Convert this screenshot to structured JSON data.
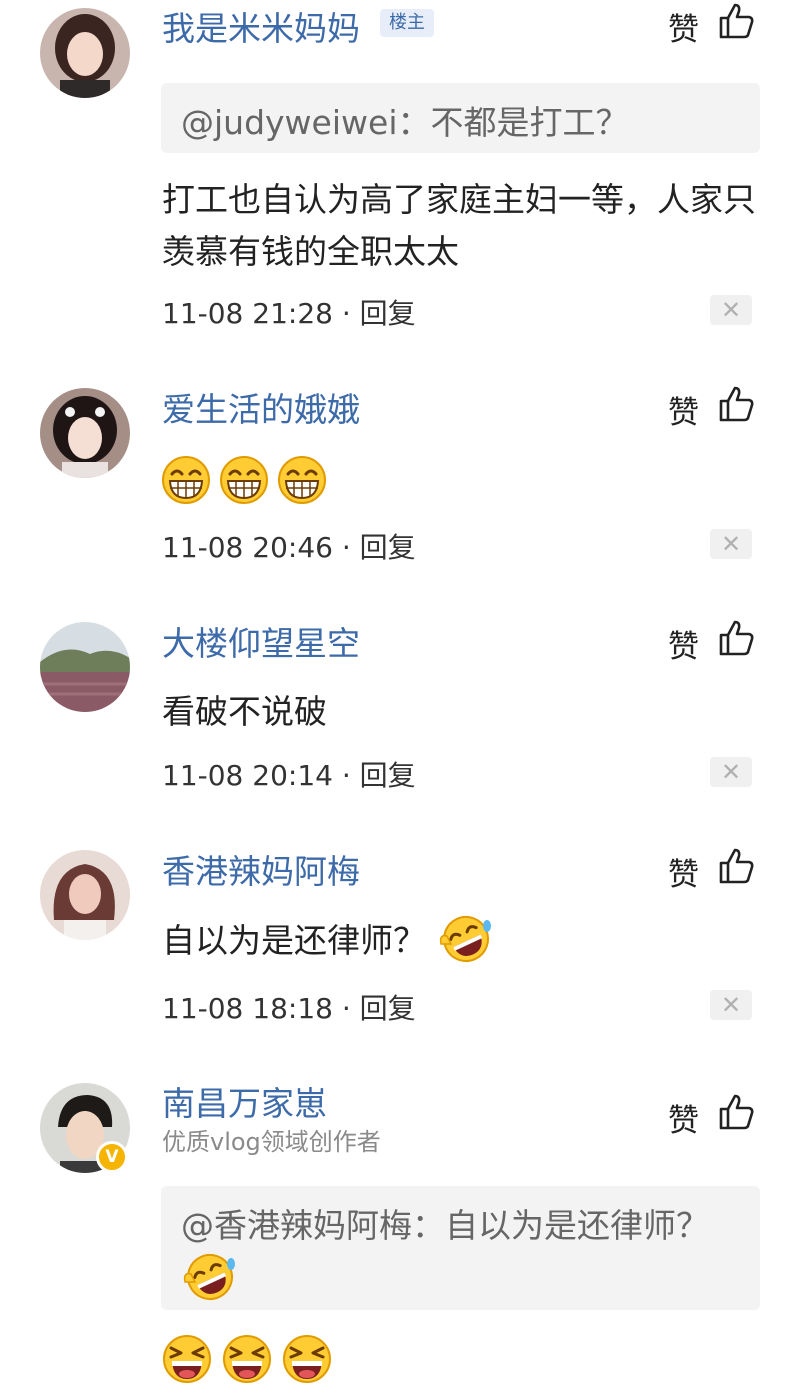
{
  "like_label": "赞",
  "close_glyph": "✕",
  "reply_sep": " · ",
  "comments": [
    {
      "username": "我是米米妈妈",
      "op_badge": "楼主",
      "quote": "@judyweiwei：不都是打工？",
      "text": "打工也自认为高了家庭主妇一等，人家只羡慕有钱的全职太太",
      "time": "11-08 21:28",
      "reply": "回复"
    },
    {
      "username": "爱生活的娥娥",
      "emojis": [
        "grin-emoji",
        "grin-emoji",
        "grin-emoji"
      ],
      "time": "11-08 20:46",
      "reply": "回复"
    },
    {
      "username": "大楼仰望星空",
      "text": "看破不说破",
      "time": "11-08 20:14",
      "reply": "回复"
    },
    {
      "username": "香港辣妈阿梅",
      "text": "自以为是还律师？",
      "text_emoji": "rofl-emoji",
      "time": "11-08 18:18",
      "reply": "回复"
    },
    {
      "username": "南昌万家崽",
      "subtitle": "优质vlog领域创作者",
      "verified_badge": "V",
      "quote": "@香港辣妈阿梅：自以为是还律师？",
      "quote_emoji": "rofl-emoji",
      "emojis": [
        "laugh-emoji",
        "laugh-emoji",
        "laugh-emoji"
      ]
    }
  ],
  "colors": {
    "username": "#3d6aa8",
    "badge_bg": "#e7eef9",
    "quote_bg": "#f3f3f3",
    "verified": "#f5b400"
  }
}
